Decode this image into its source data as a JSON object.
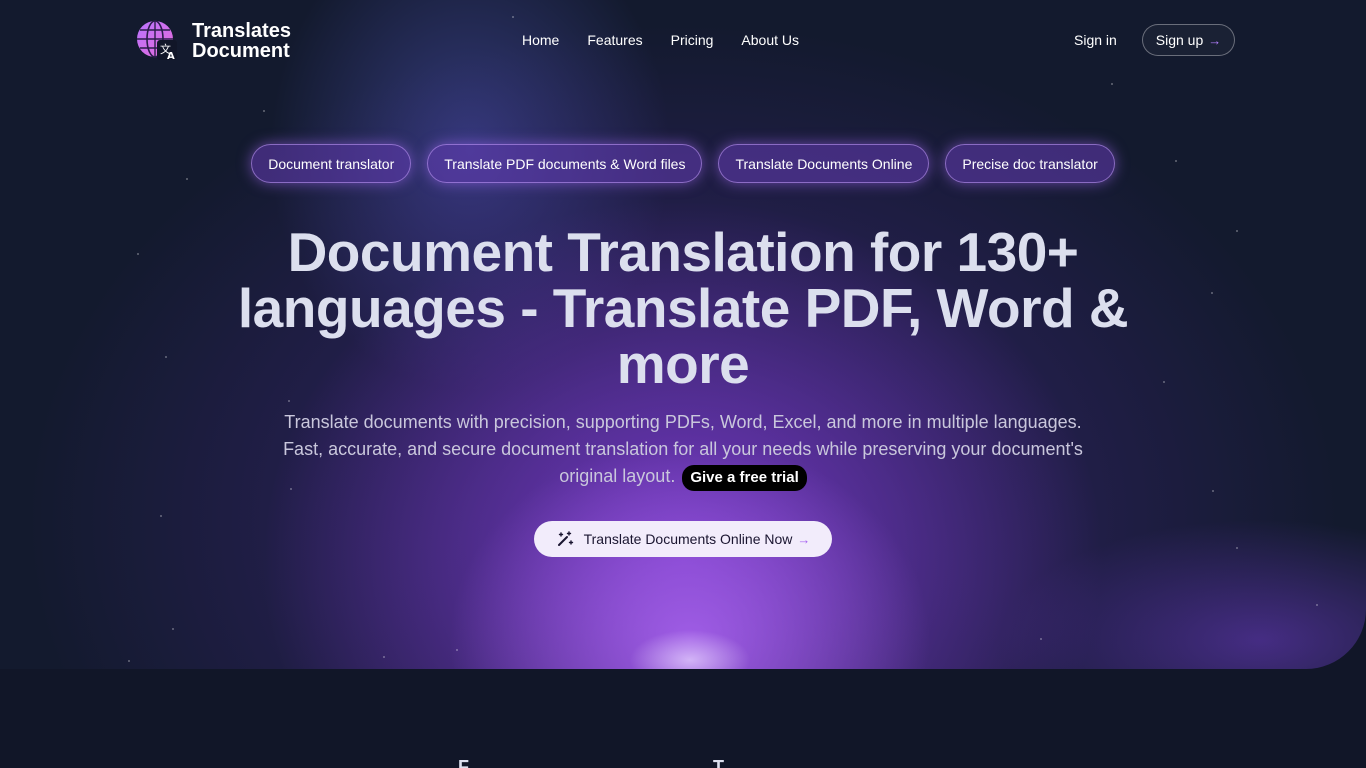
{
  "brand": {
    "line1": "Translates",
    "line2": "Document"
  },
  "nav": {
    "links": [
      "Home",
      "Features",
      "Pricing",
      "About Us"
    ],
    "signin": "Sign in",
    "signup": "Sign up",
    "signup_arrow": "→"
  },
  "chips": [
    "Document translator",
    "Translate PDF documents & Word files",
    "Translate Documents Online",
    "Precise doc translator"
  ],
  "hero": {
    "headline": "Document Translation for 130+ languages - Translate PDF, Word & more",
    "subtitle": "Translate documents with precision, supporting PDFs, Word, Excel, and more in multiple languages. Fast, accurate, and secure document translation for all your needs while preserving your document's original layout.",
    "trial_badge": "Give a free trial",
    "cta_label": "Translate Documents Online Now",
    "cta_arrow": "→"
  },
  "next_section_peek": [
    "F",
    "T"
  ]
}
